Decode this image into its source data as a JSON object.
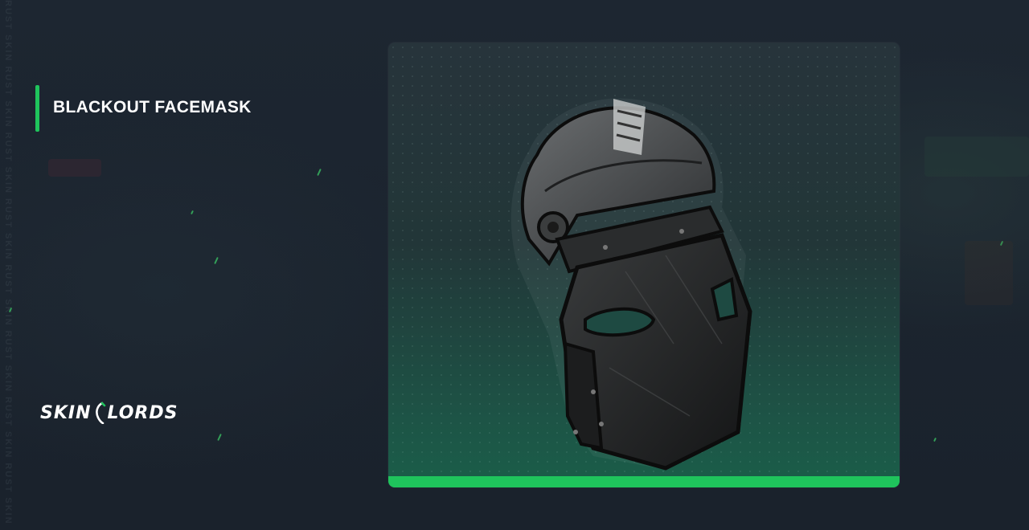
{
  "item": {
    "title": "BLACKOUT FACEMASK"
  },
  "brand": {
    "logo_text": "SKINLORDS",
    "logo_left": "SKIN",
    "logo_right": "LORDS",
    "watermark": "RUST SKIN RUST SKIN RUST SKIN RUST SKIN RUST SKIN RUST SKIN RUST SKIN RUST SKIN"
  },
  "card": {
    "image_icon": "blackout-facemask-image",
    "rarity_color": "#1fc45c"
  },
  "colors": {
    "background": "#1c2530",
    "accent": "#1fc45c"
  }
}
